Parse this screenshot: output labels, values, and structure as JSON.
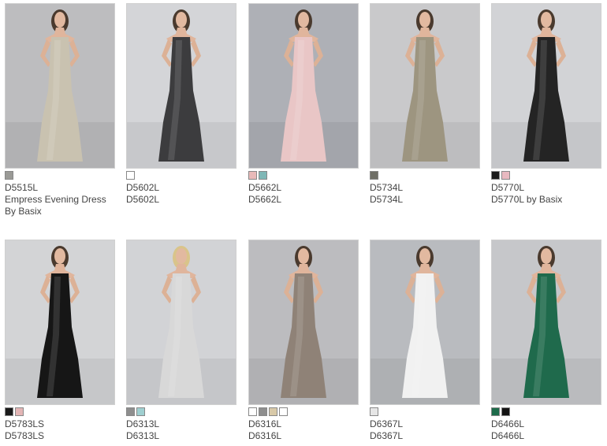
{
  "products": [
    {
      "code": "D5515L",
      "name": "Empress Evening Dress By Basix",
      "name_line1": "Empress Evening Dress",
      "name_line2": "By Basix",
      "dress": "#c9c2b0",
      "bg": "#bdbdbf",
      "swatches": [
        "#9a9a96"
      ]
    },
    {
      "code": "D5602L",
      "name": "D5602L",
      "dress": "#3c3c3e",
      "bg": "#d4d5d8",
      "swatches": [
        "#ffffff"
      ]
    },
    {
      "code": "D5662L",
      "name": "D5662L",
      "dress": "#e9c6c6",
      "bg": "#aeb0b6",
      "swatches": [
        "#e8b9b8",
        "#7fb7b6"
      ]
    },
    {
      "code": "D5734L",
      "name": "D5734L",
      "dress": "#9d9580",
      "bg": "#c9c9cb",
      "swatches": [
        "#6e6e66"
      ]
    },
    {
      "code": "D5770L",
      "name": "D5770L by Basix",
      "dress": "#242424",
      "bg": "#d2d3d6",
      "swatches": [
        "#1b1b1b",
        "#e8b9c0"
      ]
    },
    {
      "code": "D5783LS",
      "name": "D5783LS",
      "dress": "#161616",
      "bg": "#d3d4d6",
      "swatches": [
        "#1a1a1a",
        "#e3b5b5"
      ]
    },
    {
      "code": "D6313L",
      "name": "D6313L",
      "dress": "#d8d8d8",
      "bg": "#d2d3d6",
      "swatches": [
        "#8e8e8e",
        "#9fcfd0"
      ]
    },
    {
      "code": "D6316L",
      "name": "D6316L",
      "dress": "#8f8277",
      "bg": "#bcbcbf",
      "swatches": [
        "#ffffff",
        "#8e8e8e",
        "#d8c9a8",
        "#ffffff"
      ]
    },
    {
      "code": "D6367L",
      "name": "D6367L",
      "dress": "#f1f1f1",
      "bg": "#b9bbbf",
      "swatches": [
        "#e6e6e6"
      ]
    },
    {
      "code": "D6466L",
      "name": "D6466L",
      "dress": "#1f6a4c",
      "bg": "#c6c7ca",
      "swatches": [
        "#1d6b4a",
        "#141414"
      ]
    }
  ]
}
